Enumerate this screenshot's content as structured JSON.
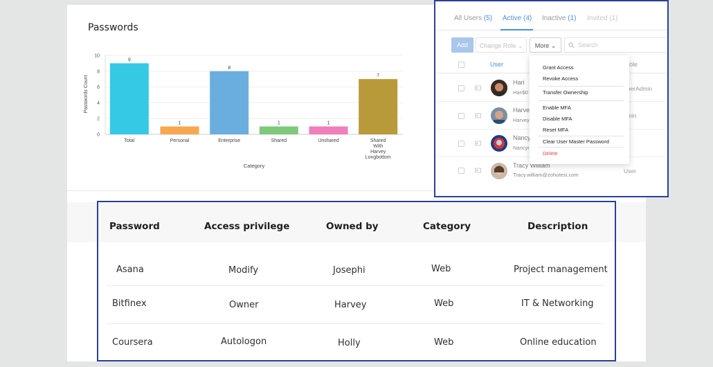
{
  "chart_title": "Passwords",
  "chart_data": {
    "type": "bar",
    "title": "",
    "xlabel": "Category",
    "ylabel": "Passwords Count",
    "ylim": [
      0,
      10
    ],
    "yticks": [
      0,
      2,
      4,
      6,
      8,
      10
    ],
    "grid": true,
    "categories": [
      "Total",
      "Personal",
      "Enterprise",
      "Shared",
      "Unshared",
      "Shared With Harvey Longbottom"
    ],
    "category_lines": [
      [
        "Total"
      ],
      [
        "Personal"
      ],
      [
        "Enterprise"
      ],
      [
        "Shared"
      ],
      [
        "Unshared"
      ],
      [
        "Shared",
        "With",
        "Harvey",
        "Longbottom"
      ]
    ],
    "values": [
      9,
      1,
      8,
      1,
      1,
      7
    ],
    "colors": [
      "#36c9e6",
      "#f7a74f",
      "#6aaee0",
      "#7ec97a",
      "#ef7eb9",
      "#b99a3b"
    ]
  },
  "users_panel": {
    "tabs": [
      {
        "label": "All Users",
        "count": "(5)",
        "state": "normal"
      },
      {
        "label": "Active",
        "count": "(4)",
        "state": "active"
      },
      {
        "label": "Inactive",
        "count": "(1)",
        "state": "normal"
      },
      {
        "label": "Invited",
        "count": "(1)",
        "state": "disabled"
      }
    ],
    "toolbar": {
      "add": "Add",
      "change_role": "Change Role",
      "more": "More"
    },
    "search_placeholder": "Search",
    "columns": {
      "user": "User",
      "role": "ole"
    },
    "users": [
      {
        "name": "Hari",
        "email": "Hari$0",
        "role": "uperAdmin"
      },
      {
        "name": "Harve",
        "email": "Harvey",
        "role": "dmin"
      },
      {
        "name": "Nancy",
        "email": "Nancyr",
        "role": "er"
      },
      {
        "name": "Tracy William",
        "email": "Tracy.william@zohotest.com",
        "role": "User"
      }
    ],
    "menu": {
      "grant": "Grant Access",
      "revoke": "Revoke Access",
      "transfer": "Transfer Ownership",
      "enable_mfa": "Enable MFA",
      "disable_mfa": "Disable MFA",
      "reset_mfa": "Reset MFA",
      "clear_master": "Clear User Master Password",
      "delete": "Delete"
    },
    "colors": {
      "accent": "#4a90d9",
      "danger": "#e0443e"
    }
  },
  "password_table": {
    "headers": {
      "password": "Password",
      "access": "Access privilege",
      "owner": "Owned by",
      "category": "Category",
      "description": "Description"
    },
    "rows": [
      {
        "password": "Asana",
        "access": "Modify",
        "owner": "Josephi",
        "category": "Web",
        "description": "Project management"
      },
      {
        "password": "Bitfinex",
        "access": "Owner",
        "owner": "Harvey",
        "category": "Web",
        "description": "IT & Networking"
      },
      {
        "password": "Coursera",
        "access": "Autologon",
        "owner": "Holly",
        "category": "Web",
        "description": "Online education"
      }
    ]
  },
  "frame_color": "#2b3f97"
}
